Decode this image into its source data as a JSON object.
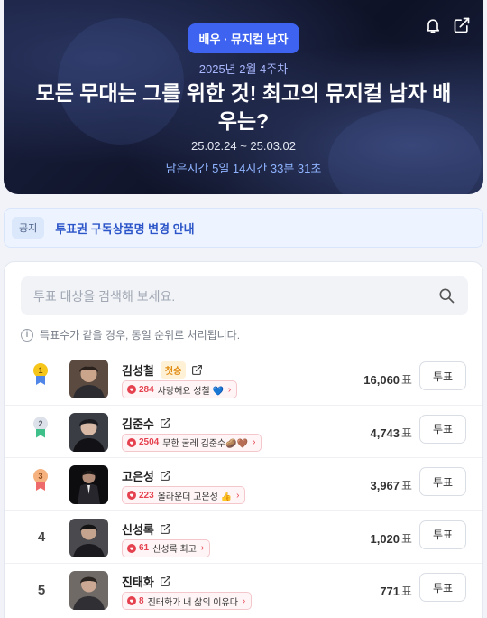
{
  "header": {
    "category_badge": "배우 · 뮤지컬 남자",
    "week": "2025년 2월 4주차",
    "title": "모든 무대는 그를 위한 것! 최고의 뮤지컬 남자 배우는?",
    "period": "25.02.24 ~ 25.03.02",
    "remaining": "남은시간 5일 14시간 33분 31초",
    "icons": [
      "bell-icon",
      "share-icon"
    ]
  },
  "notice": {
    "tag": "공지",
    "text": "투표권 구독상품명 변경 안내"
  },
  "search": {
    "placeholder": "투표 대상을 검색해 보세요."
  },
  "info_text": "득표수가 같을 경우, 동일 순위로 처리됩니다.",
  "colors": {
    "accent": "#3d63f0",
    "heart": "#e5414f",
    "gold": "#f2b705",
    "silver": "#cdd3dc",
    "bronze": "#f0a870"
  },
  "candidates": [
    {
      "rank": "1",
      "medal": "gold",
      "name": "김성철",
      "tag": "첫승",
      "cheer_count": "284",
      "cheer_msg": "사랑해요 성철 💙",
      "votes": "16,060",
      "unit": "표",
      "vote_label": "투표"
    },
    {
      "rank": "2",
      "medal": "silver",
      "name": "김준수",
      "tag": "",
      "cheer_count": "2504",
      "cheer_msg": "무한 굴레 김준수🥔🤎",
      "votes": "4,743",
      "unit": "표",
      "vote_label": "투표"
    },
    {
      "rank": "3",
      "medal": "bronze",
      "name": "고은성",
      "tag": "",
      "cheer_count": "223",
      "cheer_msg": "올라운더 고은성 👍",
      "votes": "3,967",
      "unit": "표",
      "vote_label": "투표"
    },
    {
      "rank": "4",
      "medal": "",
      "name": "신성록",
      "tag": "",
      "cheer_count": "61",
      "cheer_msg": "신성록 최고",
      "votes": "1,020",
      "unit": "표",
      "vote_label": "투표"
    },
    {
      "rank": "5",
      "medal": "",
      "name": "진태화",
      "tag": "",
      "cheer_count": "8",
      "cheer_msg": "진태화가 내 삶의 이유다",
      "votes": "771",
      "unit": "표",
      "vote_label": "투표"
    }
  ]
}
